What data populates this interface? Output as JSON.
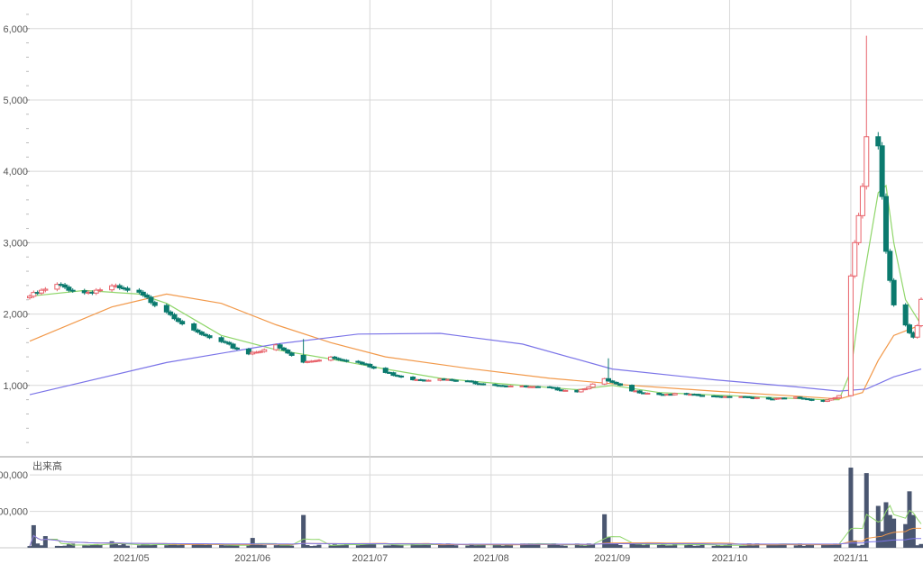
{
  "chart_data": [
    {
      "type": "candlestick",
      "name": "price",
      "ylim": [
        0,
        6300
      ],
      "yticks": [
        1000,
        2000,
        3000,
        4000,
        5000,
        6000
      ],
      "ytick_labels": [
        "1,000",
        "2,000",
        "3,000",
        "4,000",
        "5,000",
        "6,000"
      ],
      "date_range": [
        "2021-04-05",
        "2021-11-19"
      ],
      "xticks": [
        {
          "date": "2021-05-01",
          "label": "2021/05"
        },
        {
          "date": "2021-06-01",
          "label": "2021/06"
        },
        {
          "date": "2021-07-01",
          "label": "2021/07"
        },
        {
          "date": "2021-08-01",
          "label": "2021/08"
        },
        {
          "date": "2021-09-01",
          "label": "2021/09"
        },
        {
          "date": "2021-10-01",
          "label": "2021/10"
        },
        {
          "date": "2021-11-01",
          "label": "2021/11"
        }
      ],
      "grid": true,
      "colors": {
        "up": "#e8636b",
        "down": "#0b7a6e",
        "ma_short": "#8fd66a",
        "ma_mid": "#f2994a",
        "ma_long": "#7b74e8",
        "grid": "#d8d8d8"
      },
      "anchors": {
        "close": [
          [
            "2021-04-05",
            2250
          ],
          [
            "2021-04-12",
            2400
          ],
          [
            "2021-04-19",
            2300
          ],
          [
            "2021-04-26",
            2380
          ],
          [
            "2021-05-03",
            2280
          ],
          [
            "2021-05-10",
            2050
          ],
          [
            "2021-05-17",
            1750
          ],
          [
            "2021-05-24",
            1600
          ],
          [
            "2021-05-31",
            1450
          ],
          [
            "2021-06-07",
            1550
          ],
          [
            "2021-06-14",
            1320
          ],
          [
            "2021-06-21",
            1400
          ],
          [
            "2021-06-28",
            1320
          ],
          [
            "2021-07-05",
            1180
          ],
          [
            "2021-07-12",
            1090
          ],
          [
            "2021-07-19",
            1080
          ],
          [
            "2021-07-26",
            1050
          ],
          [
            "2021-08-02",
            1010
          ],
          [
            "2021-08-09",
            980
          ],
          [
            "2021-08-16",
            960
          ],
          [
            "2021-08-23",
            920
          ],
          [
            "2021-08-30",
            1080
          ],
          [
            "2021-09-06",
            920
          ],
          [
            "2021-09-13",
            880
          ],
          [
            "2021-09-20",
            870
          ],
          [
            "2021-09-27",
            840
          ],
          [
            "2021-10-04",
            850
          ],
          [
            "2021-10-11",
            800
          ],
          [
            "2021-10-18",
            830
          ],
          [
            "2021-10-25",
            780
          ],
          [
            "2021-10-29",
            850
          ],
          [
            "2021-11-01",
            2500
          ],
          [
            "2021-11-02",
            3000
          ],
          [
            "2021-11-04",
            3750
          ],
          [
            "2021-11-05",
            4450
          ],
          [
            "2021-11-08",
            4300
          ],
          [
            "2021-11-09",
            3650
          ],
          [
            "2021-11-10",
            2900
          ],
          [
            "2021-11-11",
            2500
          ],
          [
            "2021-11-12",
            2150
          ],
          [
            "2021-11-15",
            1850
          ],
          [
            "2021-11-16",
            1750
          ],
          [
            "2021-11-17",
            1700
          ],
          [
            "2021-11-18",
            1850
          ],
          [
            "2021-11-19",
            2200
          ]
        ],
        "ma_short": [
          [
            "2021-04-05",
            2250
          ],
          [
            "2021-04-19",
            2330
          ],
          [
            "2021-05-03",
            2280
          ],
          [
            "2021-05-10",
            2150
          ],
          [
            "2021-05-24",
            1700
          ],
          [
            "2021-06-07",
            1500
          ],
          [
            "2021-06-21",
            1370
          ],
          [
            "2021-07-05",
            1230
          ],
          [
            "2021-07-19",
            1100
          ],
          [
            "2021-08-02",
            1030
          ],
          [
            "2021-08-23",
            940
          ],
          [
            "2021-09-01",
            1000
          ],
          [
            "2021-09-13",
            900
          ],
          [
            "2021-10-04",
            850
          ],
          [
            "2021-10-25",
            800
          ],
          [
            "2021-10-29",
            800
          ],
          [
            "2021-11-01",
            1200
          ],
          [
            "2021-11-04",
            2400
          ],
          [
            "2021-11-08",
            3700
          ],
          [
            "2021-11-10",
            3800
          ],
          [
            "2021-11-12",
            3000
          ],
          [
            "2021-11-15",
            2200
          ],
          [
            "2021-11-19",
            1850
          ]
        ],
        "ma_mid": [
          [
            "2021-04-05",
            1620
          ],
          [
            "2021-04-26",
            2100
          ],
          [
            "2021-05-10",
            2280
          ],
          [
            "2021-05-24",
            2150
          ],
          [
            "2021-06-07",
            1850
          ],
          [
            "2021-06-21",
            1600
          ],
          [
            "2021-07-05",
            1400
          ],
          [
            "2021-07-26",
            1240
          ],
          [
            "2021-08-16",
            1100
          ],
          [
            "2021-09-06",
            1000
          ],
          [
            "2021-09-27",
            920
          ],
          [
            "2021-10-18",
            850
          ],
          [
            "2021-10-29",
            810
          ],
          [
            "2021-11-04",
            900
          ],
          [
            "2021-11-08",
            1350
          ],
          [
            "2021-11-12",
            1700
          ],
          [
            "2021-11-19",
            1850
          ]
        ],
        "ma_long": [
          [
            "2021-04-05",
            870
          ],
          [
            "2021-05-10",
            1320
          ],
          [
            "2021-06-07",
            1580
          ],
          [
            "2021-06-28",
            1720
          ],
          [
            "2021-07-19",
            1730
          ],
          [
            "2021-08-09",
            1580
          ],
          [
            "2021-09-01",
            1230
          ],
          [
            "2021-09-27",
            1080
          ],
          [
            "2021-10-18",
            980
          ],
          [
            "2021-10-29",
            920
          ],
          [
            "2021-11-05",
            950
          ],
          [
            "2021-11-12",
            1120
          ],
          [
            "2021-11-19",
            1230
          ]
        ]
      },
      "price_spikes": [
        [
          "2021-08-31",
          1380
        ],
        [
          "2021-11-05",
          5900
        ],
        [
          "2021-11-08",
          4550
        ],
        [
          "2021-06-14",
          1650
        ]
      ]
    },
    {
      "type": "bar",
      "name": "volume",
      "title": "出来高",
      "ylim": [
        0,
        230000
      ],
      "yticks": [
        100000,
        200000
      ],
      "ytick_labels": [
        "00,000",
        "00,000"
      ],
      "base_volume": 8000,
      "colors": {
        "bar": "#4a5670",
        "ma_short": "#8fd66a",
        "ma_mid": "#f2994a",
        "ma_long": "#7b74e8"
      },
      "spikes": [
        [
          "2021-04-06",
          62000
        ],
        [
          "2021-04-09",
          32000
        ],
        [
          "2021-04-26",
          18000
        ],
        [
          "2021-06-01",
          27000
        ],
        [
          "2021-06-14",
          90000
        ],
        [
          "2021-08-30",
          92000
        ],
        [
          "2021-08-31",
          30000
        ],
        [
          "2021-11-01",
          220000
        ],
        [
          "2021-11-02",
          20000
        ],
        [
          "2021-11-04",
          8000
        ],
        [
          "2021-11-05",
          205000
        ],
        [
          "2021-11-08",
          115000
        ],
        [
          "2021-11-09",
          45000
        ],
        [
          "2021-11-10",
          125000
        ],
        [
          "2021-11-11",
          90000
        ],
        [
          "2021-11-12",
          80000
        ],
        [
          "2021-11-15",
          65000
        ],
        [
          "2021-11-16",
          155000
        ],
        [
          "2021-11-17",
          90000
        ]
      ]
    }
  ]
}
